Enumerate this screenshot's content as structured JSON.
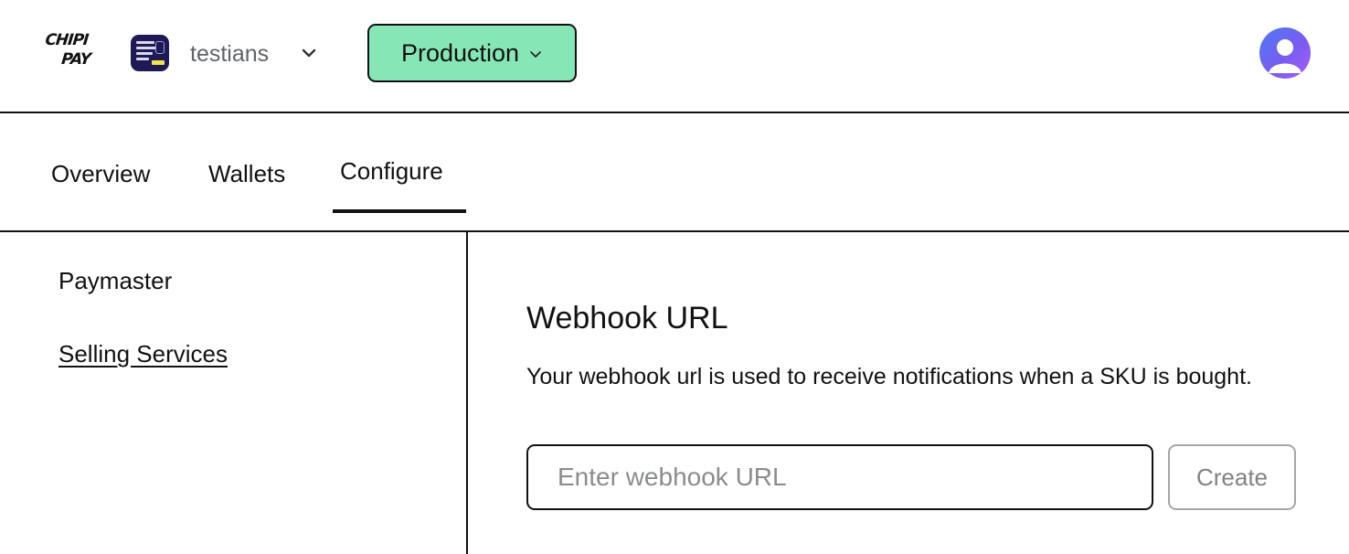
{
  "brand": {
    "logo_line1": "CHIPI",
    "logo_line2": "PAY"
  },
  "project": {
    "name": "testians",
    "avatar_icon": "project-thumbnail",
    "chevron_icon": "chevron-down-icon"
  },
  "environment": {
    "label": "Production",
    "color": "#86e6b6"
  },
  "user": {
    "avatar_icon": "user-avatar-icon"
  },
  "tabs": [
    {
      "label": "Overview"
    },
    {
      "label": "Wallets"
    },
    {
      "label": "Configure",
      "active": true
    }
  ],
  "sidebar": {
    "items": [
      {
        "label": "Paymaster"
      },
      {
        "label": "Selling Services",
        "active": true
      }
    ]
  },
  "webhook": {
    "title": "Webhook URL",
    "description": "Your webhook url is used to receive notifications when a SKU is bought.",
    "input_value": "",
    "input_placeholder": "Enter webhook URL",
    "create_label": "Create"
  }
}
